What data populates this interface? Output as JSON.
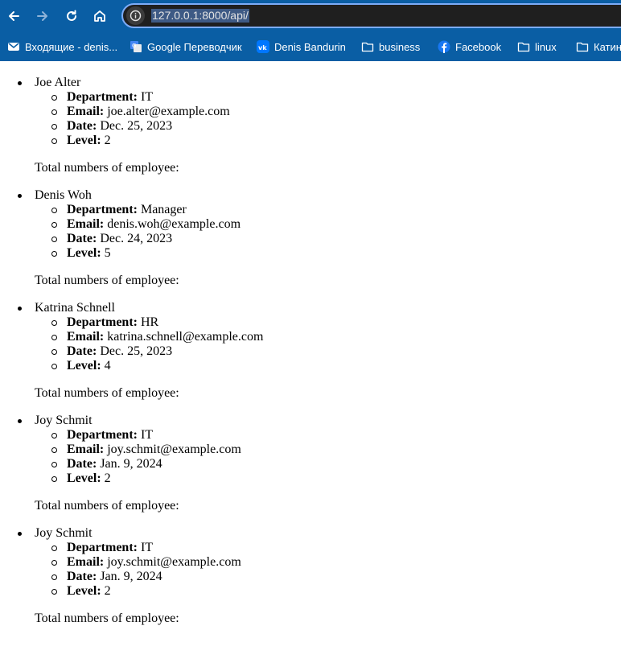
{
  "browser": {
    "url": "127.0.0.1:8000/api/",
    "bookmarks": [
      {
        "label": "Входящие - denis...",
        "icon": "mail-icon"
      },
      {
        "label": "Google Переводчик",
        "icon": "google-translate-icon"
      },
      {
        "label": "Denis Bandurin",
        "icon": "vk-icon"
      },
      {
        "label": "business",
        "icon": "folder-icon"
      },
      {
        "label": "Facebook",
        "icon": "facebook-icon"
      },
      {
        "label": "linux",
        "icon": "folder-icon"
      },
      {
        "label": "Катин",
        "icon": "folder-icon"
      }
    ],
    "accent_color": "#0a5ea4"
  },
  "labels": {
    "department": "Department:",
    "email": "Email:",
    "date": "Date:",
    "level": "Level:",
    "total": "Total numbers of employee:"
  },
  "employees": [
    {
      "name": "Joe Alter",
      "department": "IT",
      "email": "joe.alter@example.com",
      "date": "Dec. 25, 2023",
      "level": "2"
    },
    {
      "name": "Denis Woh",
      "department": "Manager",
      "email": "denis.woh@example.com",
      "date": "Dec. 24, 2023",
      "level": "5"
    },
    {
      "name": "Katrina Schnell",
      "department": "HR",
      "email": "katrina.schnell@example.com",
      "date": "Dec. 25, 2023",
      "level": "4"
    },
    {
      "name": "Joy Schmit",
      "department": "IT",
      "email": "joy.schmit@example.com",
      "date": "Jan. 9, 2024",
      "level": "2"
    },
    {
      "name": "Joy Schmit",
      "department": "IT",
      "email": "joy.schmit@example.com",
      "date": "Jan. 9, 2024",
      "level": "2"
    }
  ]
}
